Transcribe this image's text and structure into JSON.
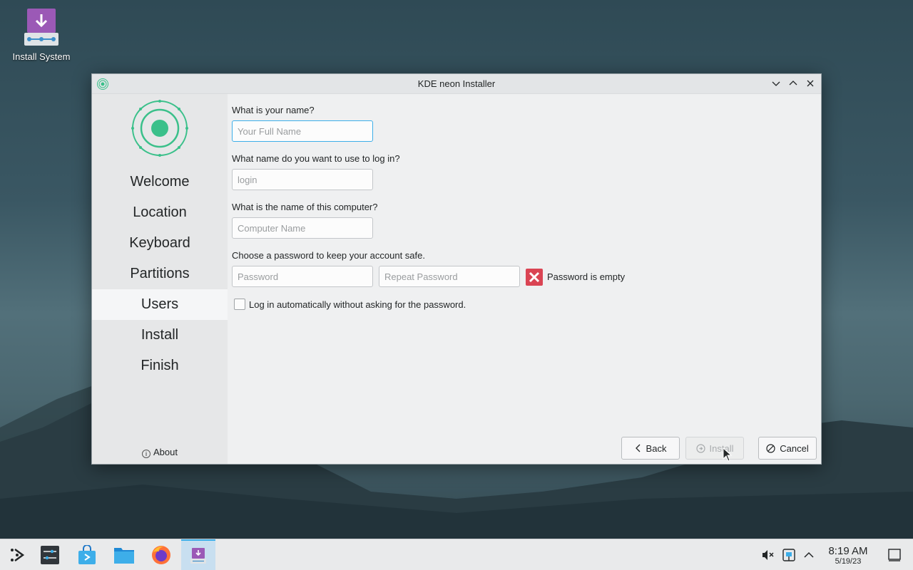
{
  "desktop": {
    "icon_label": "Install System"
  },
  "window": {
    "title": "KDE neon Installer",
    "sidebar": {
      "items": [
        {
          "label": "Welcome"
        },
        {
          "label": "Location"
        },
        {
          "label": "Keyboard"
        },
        {
          "label": "Partitions"
        },
        {
          "label": "Users",
          "active": true
        },
        {
          "label": "Install"
        },
        {
          "label": "Finish"
        }
      ],
      "about_label": "About"
    },
    "form": {
      "name_question": "What is your name?",
      "name_placeholder": "Your Full Name",
      "login_question": "What name do you want to use to log in?",
      "login_placeholder": "login",
      "computer_question": "What is the name of this computer?",
      "computer_placeholder": "Computer Name",
      "password_question": "Choose a password to keep your account safe.",
      "password_placeholder": "Password",
      "repeat_password_placeholder": "Repeat Password",
      "password_error": "Password is empty",
      "autologin_label": "Log in automatically without asking for the password."
    },
    "buttons": {
      "back": "Back",
      "install": "Install",
      "cancel": "Cancel"
    }
  },
  "taskbar": {
    "time": "8:19 AM",
    "date": "5/19/23"
  },
  "colors": {
    "accent": "#3daee9",
    "logo": "#3ac08a",
    "error": "#da4453",
    "installer": "#9b59b6"
  }
}
